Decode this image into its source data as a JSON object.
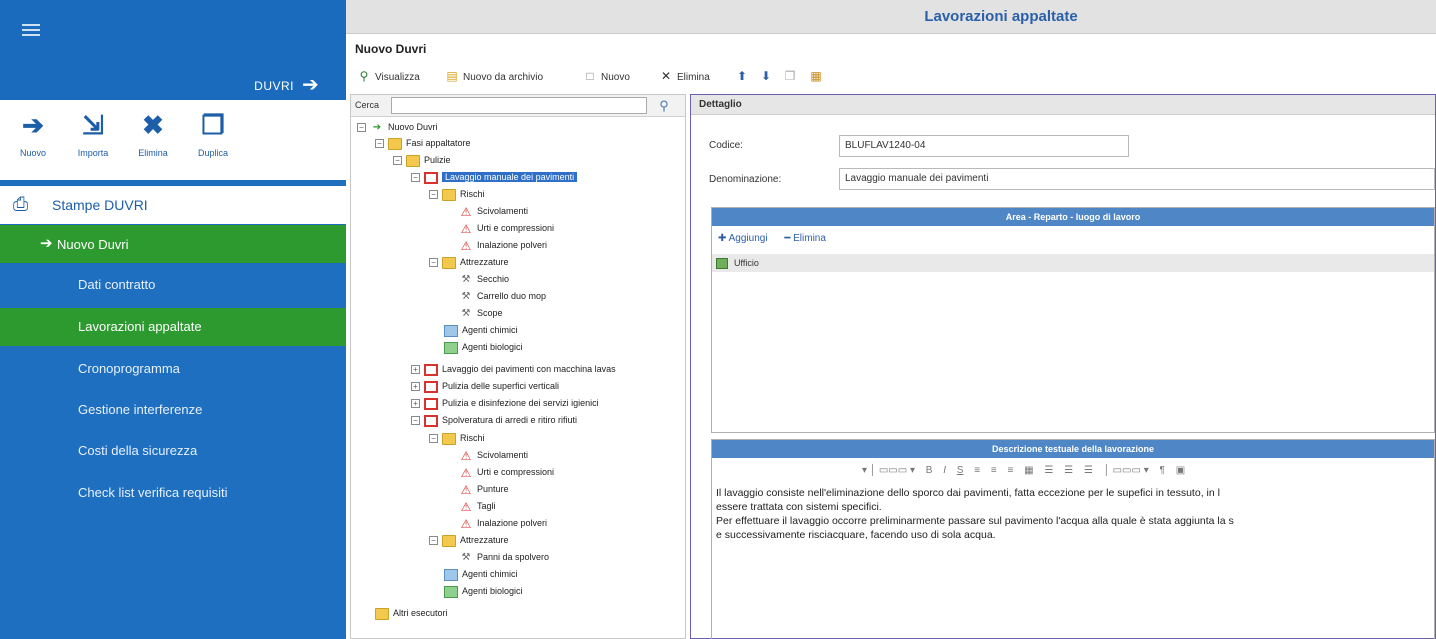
{
  "sidebar": {
    "module_title": "DUVRI",
    "actions": [
      {
        "label": "Nuovo",
        "icon": "new-icon"
      },
      {
        "label": "Importa",
        "icon": "import-icon"
      },
      {
        "label": "Elimina",
        "icon": "delete-icon"
      },
      {
        "label": "Duplica",
        "icon": "duplicate-icon"
      }
    ],
    "print_label": "Stampe DUVRI",
    "active_doc": "Nuovo Duvri",
    "items": [
      {
        "label": "Dati contratto"
      },
      {
        "label": "Lavorazioni appaltate",
        "selected": true
      },
      {
        "label": "Cronoprogramma"
      },
      {
        "label": "Gestione interferenze"
      },
      {
        "label": "Costi della sicurezza"
      },
      {
        "label": "Check list verifica requisiti"
      }
    ],
    "colors": {
      "primary": "#1f6fc0",
      "active": "#2d9a2f"
    }
  },
  "header": {
    "title": "Lavorazioni appaltate"
  },
  "section": {
    "title": "Nuovo Duvri"
  },
  "toolbar": {
    "visualizza": "Visualizza",
    "nuovo_archivio": "Nuovo da archivio",
    "nuovo": "Nuovo",
    "elimina": "Elimina"
  },
  "tree": {
    "search_label": "Cerca",
    "search_value": "",
    "nodes": {
      "root": "Nuovo Duvri",
      "fasi": "Fasi appaltatore",
      "pulizie": "Pulizie",
      "lavaggio_manuale": "Lavaggio manuale dei pavimenti",
      "rischi1": "Rischi",
      "scivolamenti1": "Scivolamenti",
      "urti1": "Urti e compressioni",
      "inalazione1": "Inalazione polveri",
      "attrezzature1": "Attrezzature",
      "secchio": "Secchio",
      "carrello": "Carrello duo mop",
      "scope": "Scope",
      "chimici1": "Agenti chimici",
      "biologici1": "Agenti biologici",
      "lavaggio_macchina": "Lavaggio dei pavimenti con macchina lavas",
      "pulizia_verticali": "Pulizia delle superfici verticali",
      "pulizia_servizi": "Pulizia e disinfezione dei servizi igienici",
      "spolveratura": "Spolveratura di arredi e ritiro rifiuti",
      "rischi2": "Rischi",
      "scivolamenti2": "Scivolamenti",
      "urti2": "Urti e compressioni",
      "punture": "Punture",
      "tagli": "Tagli",
      "inalazione2": "Inalazione polveri",
      "attrezzature2": "Attrezzature",
      "panni": "Panni da spolvero",
      "chimici2": "Agenti chimici",
      "biologici2": "Agenti biologici",
      "altri": "Altri esecutori"
    }
  },
  "detail": {
    "title": "Dettaglio",
    "codice_label": "Codice:",
    "codice_value": "BLUFLAV1240-04",
    "denominazione_label": "Denominazione:",
    "denominazione_value": "Lavaggio manuale dei pavimenti",
    "area_header": "Area - Reparto - luogo di lavoro",
    "aggiungi": "Aggiungi",
    "elimina": "Elimina",
    "area_rows": [
      "Ufficio"
    ],
    "desc_header": "Descrizione testuale della lavorazione",
    "desc_lines": [
      "Il lavaggio consiste nell'eliminazione dello sporco dai pavimenti, fatta eccezione per le supefici in tessuto, in l",
      "essere trattata con sistemi specifici.",
      "Per effettuare il lavaggio occorre preliminarmente passare sul pavimento l'acqua alla quale è stata aggiunta la s",
      "e successivamente risciacquare, facendo uso di sola acqua."
    ]
  }
}
